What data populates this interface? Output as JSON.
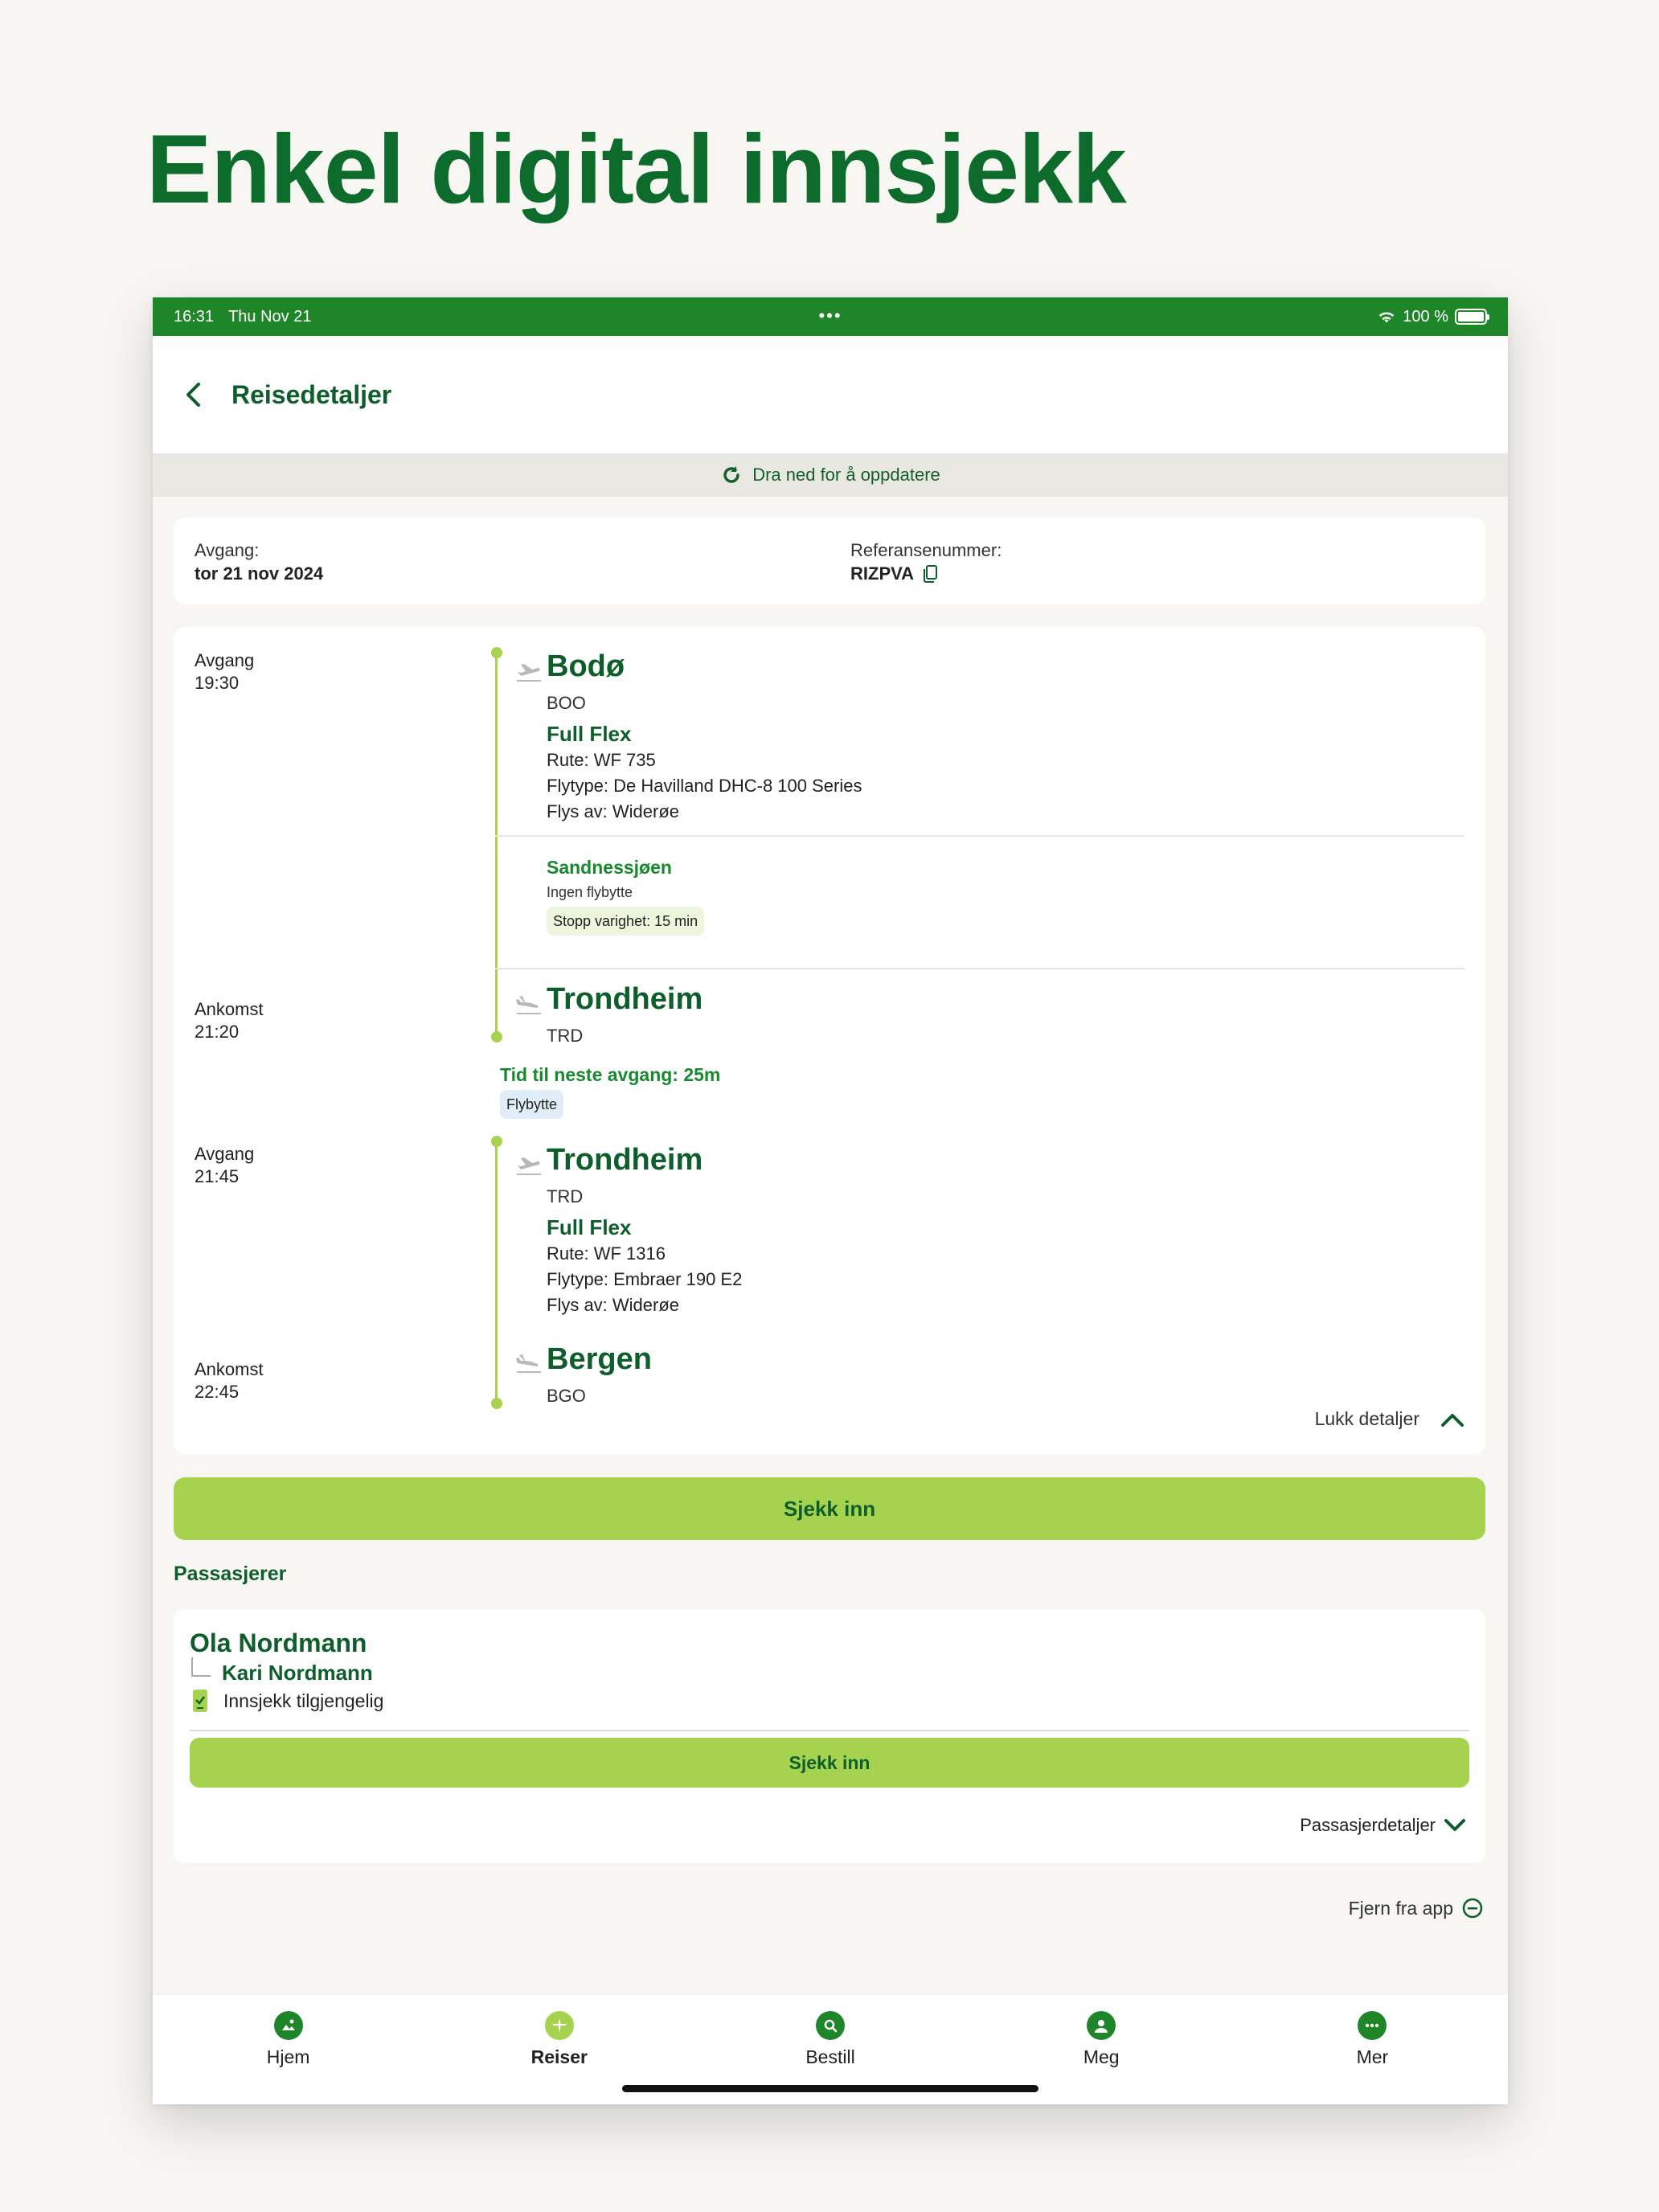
{
  "headline": "Enkel digital innsjekk",
  "status_bar": {
    "time": "16:31",
    "date": "Thu Nov 21",
    "dots": "•••",
    "battery": "100 %"
  },
  "nav": {
    "title": "Reisedetaljer"
  },
  "refresh_hint": "Dra ned for å oppdatere",
  "booking": {
    "departure_label": "Avgang:",
    "departure_value": "tor 21 nov 2024",
    "reference_label": "Referansenummer:",
    "reference_value": "RIZPVA"
  },
  "itinerary": {
    "leg1": {
      "dep_label": "Avgang",
      "dep_time": "19:30",
      "dep_city": "Bodø",
      "dep_code": "BOO",
      "fare": "Full Flex",
      "route": "Rute: WF 735",
      "aircraft": "Flytype: De Havilland DHC-8 100 Series",
      "operator": "Flys av: Widerøe",
      "stop_name": "Sandnessjøen",
      "stop_sub": "Ingen flybytte",
      "stop_duration": "Stopp varighet: 15 min",
      "arr_label": "Ankomst",
      "arr_time": "21:20",
      "arr_city": "Trondheim",
      "arr_code": "TRD"
    },
    "transfer": {
      "text": "Tid til neste avgang: 25m",
      "chip": "Flybytte"
    },
    "leg2": {
      "dep_label": "Avgang",
      "dep_time": "21:45",
      "dep_city": "Trondheim",
      "dep_code": "TRD",
      "fare": "Full Flex",
      "route": "Rute: WF 1316",
      "aircraft": "Flytype: Embraer 190 E2",
      "operator": "Flys av: Widerøe",
      "arr_label": "Ankomst",
      "arr_time": "22:45",
      "arr_city": "Bergen",
      "arr_code": "BGO"
    },
    "close_details": "Lukk detaljer"
  },
  "checkin_button": "Sjekk inn",
  "passengers": {
    "title": "Passasjerer",
    "primary": "Ola Nordmann",
    "secondary": "Kari Nordmann",
    "status": "Innsjekk tilgjengelig",
    "checkin_button": "Sjekk inn",
    "details_link": "Passasjerdetaljer"
  },
  "remove_link": "Fjern fra app",
  "tabs": [
    {
      "label": "Hjem",
      "icon": "home-icon"
    },
    {
      "label": "Reiser",
      "icon": "plane-icon"
    },
    {
      "label": "Bestill",
      "icon": "search-icon"
    },
    {
      "label": "Meg",
      "icon": "user-icon"
    },
    {
      "label": "Mer",
      "icon": "more-icon"
    }
  ],
  "colors": {
    "brand_green": "#1f8529",
    "dark_green": "#0d5e2a",
    "lime": "#a6d34f"
  }
}
